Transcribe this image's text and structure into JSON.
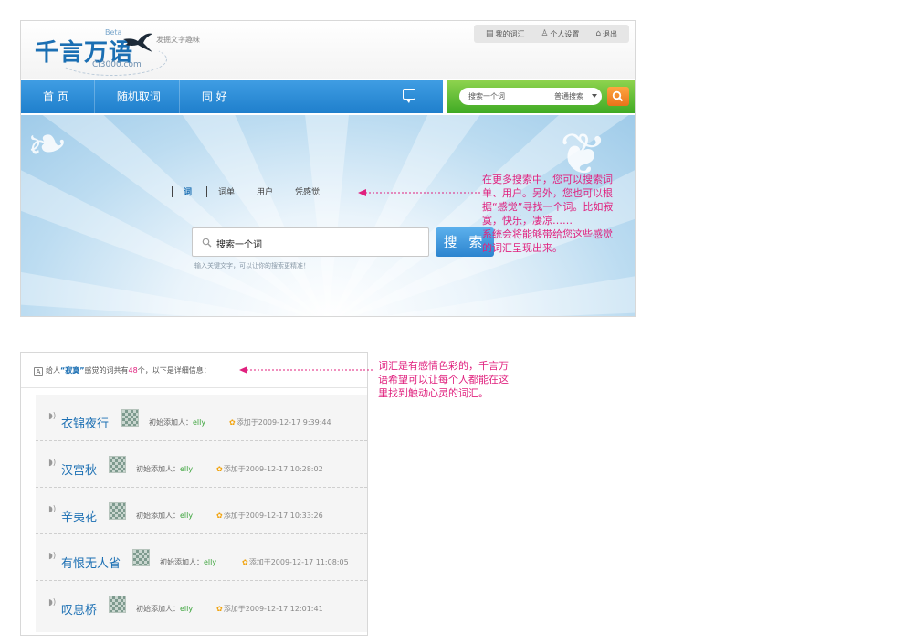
{
  "header": {
    "logo_text": "千言万语",
    "logo_beta": "Beta",
    "logo_url": "Ci3000.com",
    "slogan": "发掘文字趣味",
    "user_links": [
      "我的词汇",
      "个人设置",
      "退出"
    ]
  },
  "nav": {
    "items": [
      "首 页",
      "随机取词",
      "同 好"
    ]
  },
  "top_search": {
    "placeholder": "搜索一个词",
    "mode": "普通搜索"
  },
  "hero": {
    "tabs": [
      "词",
      "词单",
      "用户",
      "凭感觉"
    ],
    "search_placeholder": "搜索一个词",
    "search_button": "搜 索",
    "hint": "输入关键文字，可以让你的搜索更精准！"
  },
  "annotations": {
    "note1": "在更多搜索中，您可以搜索词单、用户。另外，您也可以根据“感觉”寻找一个词。比如寂寞，快乐，凄凉……\n系统会将能够带给您这些感觉的词汇呈现出来。",
    "note2": "词汇是有感情色彩的，千言万语希望可以让每个人都能在这里找到触动心灵的词汇。"
  },
  "results": {
    "info_prefix": "给人",
    "info_word": "“寂寞”",
    "info_middle": "感觉的词共有",
    "info_count": "48",
    "info_suffix": "个，以下是详细信息：",
    "adder_label": "初始添加人：",
    "items": [
      {
        "word": "衣锦夜行",
        "user": "elly",
        "date": "添加于2009-12-17 9:39:44"
      },
      {
        "word": "汉宫秋",
        "user": "elly",
        "date": "添加于2009-12-17 10:28:02"
      },
      {
        "word": "辛夷花",
        "user": "elly",
        "date": "添加于2009-12-17 10:33:26"
      },
      {
        "word": "有恨无人省",
        "user": "elly",
        "date": "添加于2009-12-17 11:08:05"
      },
      {
        "word": "叹息桥",
        "user": "elly",
        "date": "添加于2009-12-17 12:01:41"
      }
    ]
  },
  "colors": {
    "brand_blue": "#1b6fb3",
    "annotation_pink": "#e0217e",
    "nav_blue": "#2f8fd9",
    "nav_green": "#5cbf37",
    "search_orange": "#f28a2a"
  }
}
